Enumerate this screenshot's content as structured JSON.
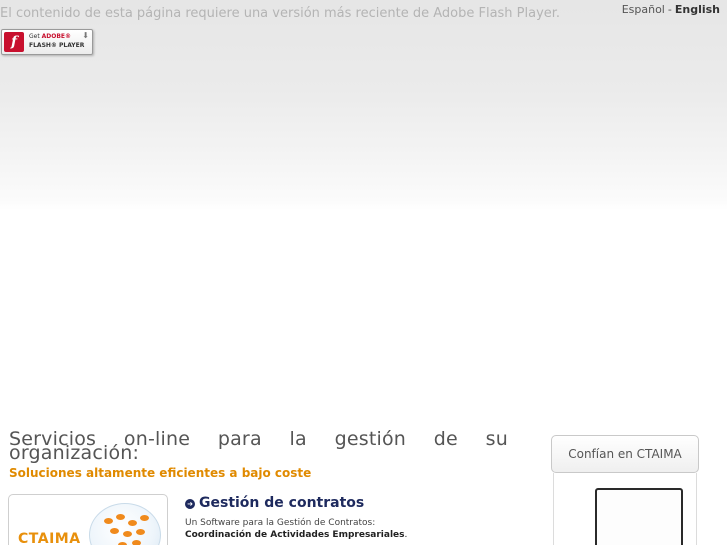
{
  "flash_notice": {
    "message": "El contenido de esta página requiere una versión más reciente de Adobe Flash Player.",
    "badge": {
      "line1_prefix": "Get",
      "line1_brand": "ADOBE®",
      "line2": "FLASH® PLAYER",
      "logo_glyph": "f"
    }
  },
  "language": {
    "options": [
      "Español",
      "English"
    ],
    "separator": "-",
    "active": "English"
  },
  "main": {
    "headline": "Servicios on-line para la gestión de su organización:",
    "subheadline": "Soluciones altamente eficientes a bajo coste",
    "product": {
      "title": "Gestión de contratos",
      "description": "Un Software para la Gestión de Contratos:",
      "description_bold": "Coordinación de Actividades Empresariales",
      "description_end": ".",
      "logo_text": "CTAIMA"
    }
  },
  "sidebar": {
    "trust_heading": "Confían en CTAIMA"
  },
  "colors": {
    "accent_orange": "#e08a00",
    "navy": "#1e2a5e",
    "flash_red": "#c8102e"
  }
}
